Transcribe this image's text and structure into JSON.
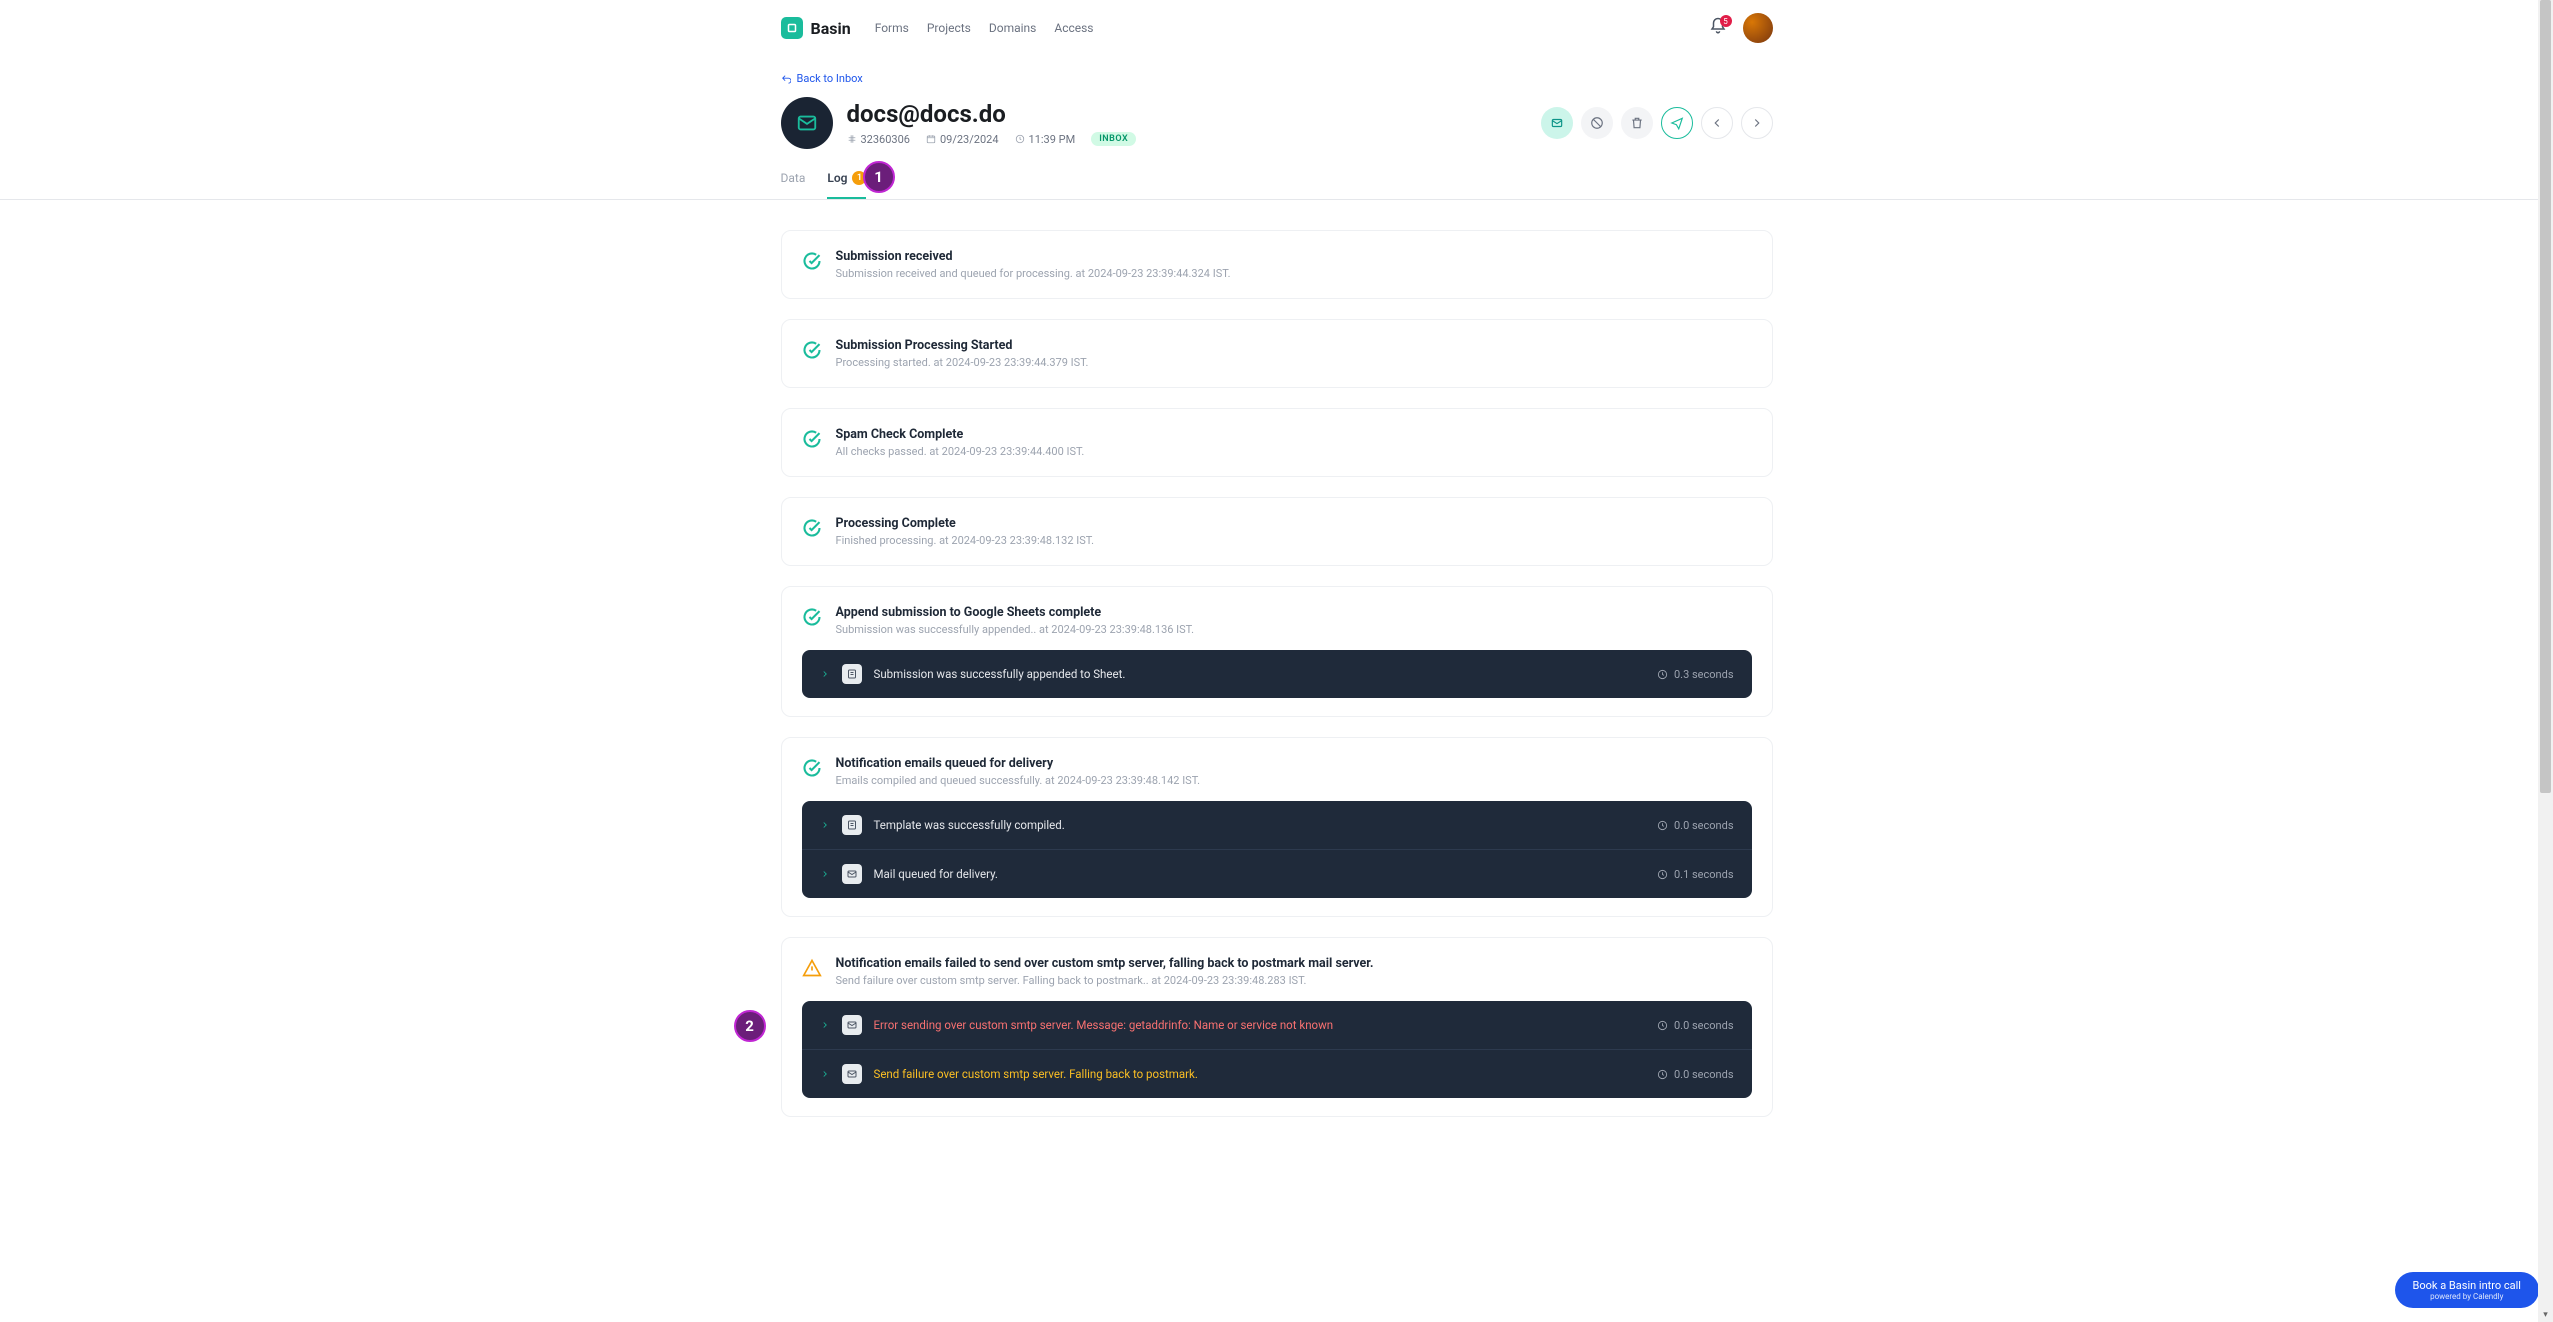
{
  "brand": "Basin",
  "nav": {
    "forms": "Forms",
    "projects": "Projects",
    "domains": "Domains",
    "access": "Access"
  },
  "notif_count": "5",
  "back": "Back to Inbox",
  "submission": {
    "title": "docs@docs.do",
    "id": "32360306",
    "date": "09/23/2024",
    "time": "11:39 PM",
    "status": "INBOX"
  },
  "tabs": {
    "data": "Data",
    "log": "Log",
    "log_badge": "1"
  },
  "log": [
    {
      "ok": true,
      "title": "Submission received",
      "desc": "Submission received and queued for processing. at 2024-09-23 23:39:44.324 IST.",
      "rows": []
    },
    {
      "ok": true,
      "title": "Submission Processing Started",
      "desc": "Processing started. at 2024-09-23 23:39:44.379 IST.",
      "rows": []
    },
    {
      "ok": true,
      "title": "Spam Check Complete",
      "desc": "All checks passed. at 2024-09-23 23:39:44.400 IST.",
      "rows": []
    },
    {
      "ok": true,
      "title": "Processing Complete",
      "desc": "Finished processing. at 2024-09-23 23:39:48.132 IST.",
      "rows": []
    },
    {
      "ok": true,
      "title": "Append submission to Google Sheets complete",
      "desc": "Submission was successfully appended.. at 2024-09-23 23:39:48.136 IST.",
      "rows": [
        {
          "icon": "sheet",
          "text": "Submission was successfully appended to Sheet.",
          "style": "norm",
          "time": "0.3 seconds"
        }
      ]
    },
    {
      "ok": true,
      "title": "Notification emails queued for delivery",
      "desc": "Emails compiled and queued successfully. at 2024-09-23 23:39:48.142 IST.",
      "rows": [
        {
          "icon": "sheet",
          "text": "Template was successfully compiled.",
          "style": "norm",
          "time": "0.0 seconds"
        },
        {
          "icon": "mail",
          "text": "Mail queued for delivery.",
          "style": "norm",
          "time": "0.1 seconds"
        }
      ]
    },
    {
      "ok": false,
      "title": "Notification emails failed to send over custom smtp server, falling back to postmark mail server.",
      "desc": "Send failure over custom smtp server. Falling back to postmark.. at 2024-09-23 23:39:48.283 IST.",
      "rows": [
        {
          "icon": "mail",
          "text": "Error sending over custom smtp server. Message: getaddrinfo: Name or service not known",
          "style": "err",
          "time": "0.0 seconds"
        },
        {
          "icon": "mail",
          "text": "Send failure over custom smtp server. Falling back to postmark.",
          "style": "warn",
          "time": "0.0 seconds"
        }
      ]
    }
  ],
  "annotations": {
    "a1": "1",
    "a2": "2"
  },
  "calendly": {
    "main": "Book a Basin intro call",
    "sub": "powered by Calendly"
  }
}
